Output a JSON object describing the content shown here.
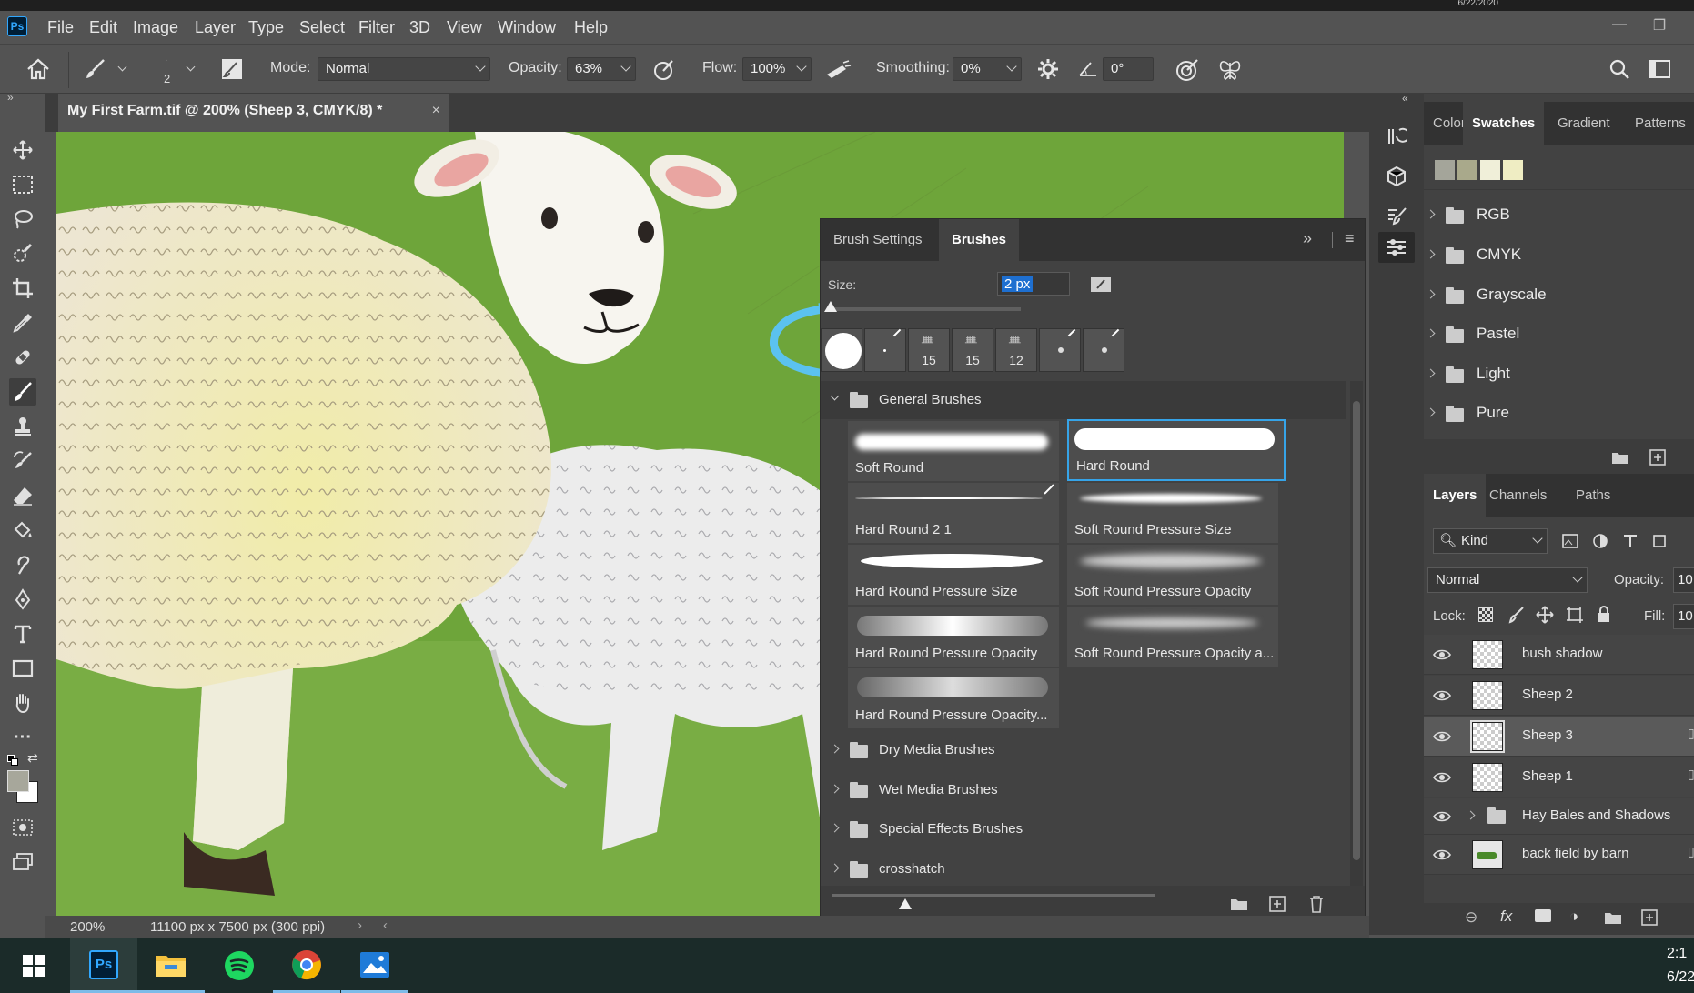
{
  "system": {
    "date_top": "6/22/2020",
    "clock": "2:1",
    "date_bottom": "6/22"
  },
  "menu": [
    "File",
    "Edit",
    "Image",
    "Layer",
    "Type",
    "Select",
    "Filter",
    "3D",
    "View",
    "Window",
    "Help"
  ],
  "app_logo": "Ps",
  "options": {
    "brush_size": "2",
    "mode_label": "Mode:",
    "mode_value": "Normal",
    "opacity_label": "Opacity:",
    "opacity_value": "63%",
    "flow_label": "Flow:",
    "flow_value": "100%",
    "smoothing_label": "Smoothing:",
    "smoothing_value": "0%",
    "angle_value": "0°"
  },
  "document": {
    "tab_title": "My First Farm.tif @ 200% (Sheep 3, CMYK/8) *",
    "close": "×",
    "zoom": "200%",
    "dimensions": "11100 px x 7500 px (300 ppi)"
  },
  "brushes_panel": {
    "tabs": [
      "Brush Settings",
      "Brushes"
    ],
    "active_tab": "Brushes",
    "size_label": "Size:",
    "size_value": "2 px",
    "recent_presets": [
      {
        "label": ""
      },
      {
        "label": ""
      },
      {
        "label": "15"
      },
      {
        "label": "15"
      },
      {
        "label": "12"
      },
      {
        "label": ""
      },
      {
        "label": ""
      }
    ],
    "general_group": "General Brushes",
    "brushes": [
      "Soft Round",
      "Hard Round",
      "Hard Round 2 1",
      "Soft Round Pressure Size",
      "Hard Round Pressure Size",
      "Soft Round Pressure Opacity",
      "Hard Round Pressure Opacity",
      "Soft Round Pressure Opacity a...",
      "Hard Round Pressure Opacity..."
    ],
    "selected_brush": "Hard Round",
    "groups": [
      "Dry Media Brushes",
      "Wet Media Brushes",
      "Special Effects Brushes",
      "crosshatch"
    ]
  },
  "right_top": {
    "tabs": [
      "Color",
      "Swatches",
      "Gradient",
      "Patterns"
    ],
    "active_tab": "Swatches",
    "swatch_colors": [
      "#a4a59a",
      "#a9a98b",
      "#f0efd9",
      "#efedc3"
    ],
    "folders": [
      "RGB",
      "CMYK",
      "Grayscale",
      "Pastel",
      "Light",
      "Pure"
    ]
  },
  "layers_panel": {
    "tabs": [
      "Layers",
      "Channels",
      "Paths"
    ],
    "active_tab": "Layers",
    "kind_label": "Kind",
    "blend_mode": "Normal",
    "opacity_label": "Opacity:",
    "opacity_value": "10",
    "lock_label": "Lock:",
    "fill_label": "Fill:",
    "fill_value": "10",
    "layers": [
      "bush shadow",
      "Sheep 2",
      "Sheep 3",
      "Sheep 1",
      "Hay Bales and Shadows",
      "back field by barn"
    ],
    "selected_layer": "Sheep 3"
  },
  "colors": {
    "highlight_circle": "#5bc2ef",
    "selection_border": "#36a4e8",
    "grass": "#6ea53a"
  }
}
